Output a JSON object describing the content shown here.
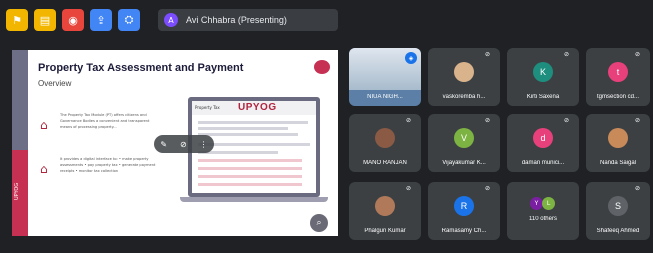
{
  "toolbar": {
    "buttons": [
      {
        "icon": "flag-icon",
        "color": "#f2b600",
        "glyph": "⚑"
      },
      {
        "icon": "document-icon",
        "color": "#f2b600",
        "glyph": "▤"
      },
      {
        "icon": "record-icon",
        "color": "#e8453c",
        "glyph": "◉"
      },
      {
        "icon": "share-icon",
        "color": "#4285f4",
        "glyph": "⇪"
      },
      {
        "icon": "people-icon",
        "color": "#4285f4",
        "glyph": "⛭"
      }
    ]
  },
  "presenter": {
    "initial": "A",
    "label": "Avi Chhabra (Presenting)"
  },
  "slide": {
    "title": "Property Tax Assessment and Payment",
    "subtitle": "Overview",
    "side_label": "UPYOG",
    "para1": "The Property Tax Module (PT) offers citizens and Governance Bodies a convenient and transparent means of processing property...",
    "para2": "It provides a digital interface to: • make property assessments • pay property tax • generate payment receipts • monitor tax collection",
    "laptop_title": "UPYOG",
    "laptop_caption": "Property Tax"
  },
  "tiles": [
    {
      "name": "NIUA NIGH...",
      "type": "photo",
      "color": "#5b7fa6",
      "active": true
    },
    {
      "name": "vaskoremba h...",
      "type": "photo",
      "color": "#d9b38c"
    },
    {
      "name": "Kirti Saxena",
      "type": "initial",
      "initial": "K",
      "color": "#1e8e7e"
    },
    {
      "name": "tgmsection cd...",
      "type": "initial",
      "initial": "t",
      "color": "#e8407a"
    },
    {
      "name": "MANO RANJAN",
      "type": "photo",
      "color": "#8a5a44"
    },
    {
      "name": "Vijayakumar K...",
      "type": "initial",
      "initial": "V",
      "color": "#7cb342"
    },
    {
      "name": "daman munici...",
      "type": "initial",
      "initial": "d",
      "color": "#e8407a"
    },
    {
      "name": "Nanda Saigal",
      "type": "photo",
      "color": "#c98a5a"
    },
    {
      "name": "Phalgun Kumar",
      "type": "photo",
      "color": "#b07a5a"
    },
    {
      "name": "Ramasamy Ch...",
      "type": "initial",
      "initial": "R",
      "color": "#1a73e8"
    },
    {
      "name": "110 others",
      "type": "others",
      "initials": [
        "Y",
        "L"
      ],
      "colors": [
        "#7b1fa2",
        "#7cb342"
      ]
    },
    {
      "name": "Shafeeq Ahmed",
      "type": "initial",
      "initial": "S",
      "color": "#5f6368"
    }
  ]
}
